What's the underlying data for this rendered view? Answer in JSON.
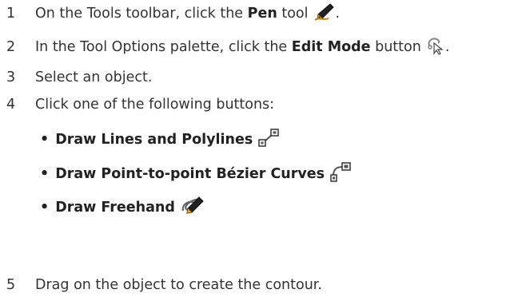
{
  "steps": [
    {
      "num": "1",
      "pre": "On the Tools toolbar, click the ",
      "bold": "Pen",
      "post": " tool",
      "icon": "pen-tool-icon",
      "tail": "."
    },
    {
      "num": "2",
      "pre": "In the Tool Options palette, click the ",
      "bold": "Edit Mode",
      "post": " button",
      "icon": "edit-mode-icon",
      "tail": "."
    },
    {
      "num": "3",
      "text": "Select an object."
    },
    {
      "num": "4",
      "text": "Click one of the following buttons:",
      "options": [
        {
          "bullet": "•",
          "label": "Draw Lines and Polylines",
          "icon": "draw-lines-polylines-icon"
        },
        {
          "bullet": "•",
          "label": "Draw Point-to-point Bézier Curves",
          "icon": "draw-bezier-curves-icon"
        },
        {
          "bullet": "•",
          "label": "Draw Freehand",
          "icon": "draw-freehand-icon"
        }
      ]
    },
    {
      "num": "5",
      "text": "Drag on the object to create the contour."
    }
  ],
  "colors": {
    "text": "#333333",
    "icon_outline": "#555555",
    "icon_fill": "#ffffff",
    "pen_nib": "#e8a317",
    "pen_body": "#222222"
  }
}
